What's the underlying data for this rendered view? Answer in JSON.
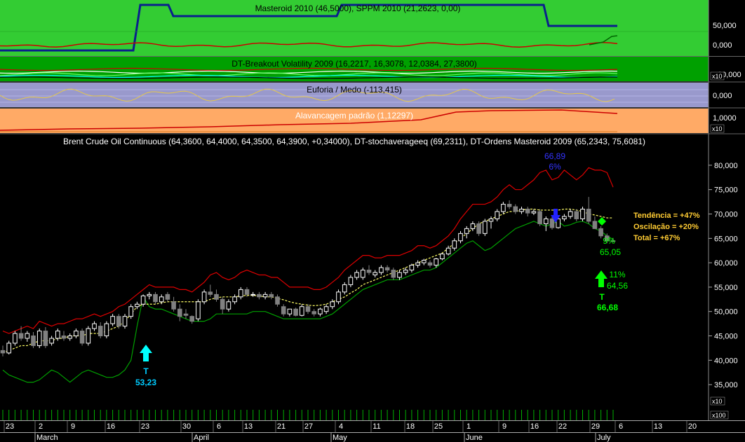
{
  "panels": {
    "p1": {
      "title": "Masteroid 2010 (46,5000), SPPM 2010 (21,2623, 0,00)",
      "ticks": [
        "50,000",
        "0,000"
      ]
    },
    "p2": {
      "title": "DT-Breakout Volatility 2009 (16,2217, 16,3078, 12,0384, 27,3800)",
      "ticks": [
        "10,000"
      ],
      "scale": "x10"
    },
    "p3": {
      "title": "Euforia / Medo (-113,415)",
      "ticks": [
        "0,000"
      ]
    },
    "p4": {
      "title": "Alavancagem padrão (1,12297)",
      "ticks": [
        "1,0000"
      ],
      "scale": "x10"
    },
    "main": {
      "title": "Brent Crude Oil Continuous (64,3600, 64,4000, 64,3500, 64,3900, +0,34000), DT-stochaverageeq (69,2311), DT-Ordens Masteroid 2009 (65,2343, 75,6081)",
      "volume_scales": [
        "x10",
        "x100"
      ]
    }
  },
  "annotations": {
    "buy1_label": "T",
    "buy1_price": "53,23",
    "sell_price": "66,89",
    "sell_pct": "6%",
    "pct_a": "9%",
    "price_a": "65,05",
    "pct_b": "11%",
    "price_b": "64,56",
    "buy2_label": "T",
    "buy2_price": "66,68"
  },
  "stats": [
    "Tendência = +47%",
    "Oscilação = +20%",
    "Total = +67%"
  ],
  "colors": {
    "panel1": "#33cc33",
    "panel2": "#00a000",
    "panel3": "#9999cc",
    "panel4": "#ffaa66",
    "up": "#ffffff",
    "down": "#808080",
    "upper_band": "#dd0000",
    "lower_band": "#00a000",
    "average": "#ffff66",
    "buy_arrow": "#00ffff",
    "sell_arrow": "#2222ff",
    "green_arrow": "#00ff00"
  },
  "chart_data": {
    "type": "candlestick",
    "ylim": [
      32,
      83
    ],
    "y_ticks": [
      "35,000",
      "40,000",
      "45,000",
      "50,000",
      "55,000",
      "60,000",
      "65,000",
      "70,000",
      "75,000",
      "80,000"
    ],
    "x_labels": [
      "23",
      "2",
      "9",
      "16",
      "23",
      "30",
      "6",
      "13",
      "21",
      "27",
      "4",
      "11",
      "18",
      "25",
      "1",
      "9",
      "16",
      "22",
      "29",
      "6",
      "13",
      "20"
    ],
    "months": [
      "March",
      "April",
      "May",
      "June",
      "July"
    ],
    "ohlc": [
      [
        42.0,
        43.0,
        40.8,
        41.5
      ],
      [
        41.5,
        44.0,
        41.2,
        43.5
      ],
      [
        43.5,
        46.0,
        43.0,
        45.5
      ],
      [
        45.5,
        47.0,
        44.0,
        44.5
      ],
      [
        44.5,
        46.0,
        43.8,
        45.5
      ],
      [
        45.0,
        45.8,
        42.5,
        43.0
      ],
      [
        43.0,
        46.5,
        42.5,
        46.0
      ],
      [
        46.0,
        46.8,
        42.5,
        43.0
      ],
      [
        43.5,
        45.0,
        43.0,
        44.5
      ],
      [
        44.5,
        46.5,
        44.0,
        46.0
      ],
      [
        45.0,
        46.0,
        44.0,
        44.5
      ],
      [
        44.5,
        45.5,
        44.0,
        45.0
      ],
      [
        45.0,
        46.5,
        44.5,
        46.0
      ],
      [
        46.0,
        46.5,
        43.0,
        43.5
      ],
      [
        43.5,
        47.0,
        43.0,
        46.5
      ],
      [
        46.5,
        48.0,
        46.0,
        47.5
      ],
      [
        47.0,
        47.8,
        44.5,
        45.0
      ],
      [
        45.0,
        48.0,
        44.5,
        47.5
      ],
      [
        47.5,
        49.5,
        47.0,
        49.0
      ],
      [
        49.0,
        49.5,
        46.5,
        47.0
      ],
      [
        47.0,
        49.5,
        46.5,
        49.0
      ],
      [
        49.0,
        51.5,
        48.5,
        51.0
      ],
      [
        51.0,
        52.0,
        50.5,
        51.5
      ],
      [
        51.5,
        53.5,
        51.0,
        53.2
      ],
      [
        53.2,
        54.0,
        52.5,
        53.5
      ],
      [
        53.5,
        54.0,
        51.5,
        52.0
      ],
      [
        52.0,
        53.5,
        51.5,
        53.0
      ],
      [
        53.5,
        54.0,
        52.0,
        52.5
      ],
      [
        52.0,
        53.0,
        50.0,
        50.5
      ],
      [
        50.5,
        51.5,
        48.0,
        49.0
      ],
      [
        49.5,
        50.5,
        48.5,
        49.2
      ],
      [
        49.0,
        49.2,
        47.5,
        48.0
      ],
      [
        48.5,
        52.5,
        48.0,
        52.0
      ],
      [
        52.0,
        54.5,
        51.5,
        54.0
      ],
      [
        54.0,
        55.5,
        53.0,
        53.5
      ],
      [
        53.5,
        54.5,
        52.0,
        52.5
      ],
      [
        52.5,
        53.0,
        49.5,
        50.5
      ],
      [
        50.5,
        52.5,
        50.0,
        52.0
      ],
      [
        52.0,
        53.5,
        51.5,
        53.0
      ],
      [
        53.0,
        55.0,
        52.5,
        54.5
      ],
      [
        54.5,
        55.0,
        53.0,
        53.5
      ],
      [
        53.5,
        54.0,
        53.0,
        53.5
      ],
      [
        53.5,
        54.0,
        52.5,
        53.0
      ],
      [
        53.0,
        54.0,
        52.5,
        53.5
      ],
      [
        53.5,
        54.0,
        52.5,
        53.0
      ],
      [
        53.0,
        53.5,
        51.0,
        51.5
      ],
      [
        51.0,
        51.5,
        49.0,
        49.5
      ],
      [
        49.5,
        50.5,
        49.0,
        50.5
      ],
      [
        50.5,
        50.8,
        49.0,
        49.2
      ],
      [
        49.2,
        51.5,
        49.0,
        51.0
      ],
      [
        51.0,
        51.5,
        49.5,
        50.0
      ],
      [
        50.0,
        50.5,
        49.0,
        49.5
      ],
      [
        49.5,
        50.8,
        49.0,
        50.5
      ],
      [
        50.0,
        51.5,
        49.5,
        51.0
      ],
      [
        51.0,
        52.5,
        50.5,
        52.0
      ],
      [
        52.0,
        54.5,
        51.5,
        54.0
      ],
      [
        54.0,
        56.0,
        53.5,
        55.5
      ],
      [
        55.5,
        57.5,
        55.0,
        57.0
      ],
      [
        57.0,
        58.5,
        56.5,
        58.0
      ],
      [
        57.0,
        59.0,
        56.5,
        58.5
      ],
      [
        58.5,
        59.5,
        57.5,
        58.0
      ],
      [
        57.5,
        58.5,
        57.0,
        58.0
      ],
      [
        58.0,
        59.5,
        57.5,
        59.0
      ],
      [
        59.0,
        59.5,
        58.0,
        58.5
      ],
      [
        58.5,
        59.0,
        56.5,
        57.0
      ],
      [
        57.0,
        58.5,
        56.5,
        58.0
      ],
      [
        58.0,
        59.0,
        57.5,
        58.5
      ],
      [
        58.5,
        59.8,
        58.0,
        59.5
      ],
      [
        59.5,
        60.5,
        59.0,
        60.0
      ],
      [
        60.0,
        60.8,
        59.5,
        60.5
      ],
      [
        60.0,
        60.5,
        59.0,
        59.5
      ],
      [
        59.5,
        61.0,
        59.0,
        60.8
      ],
      [
        60.8,
        62.0,
        60.5,
        61.8
      ],
      [
        61.8,
        63.5,
        61.5,
        63.0
      ],
      [
        63.0,
        65.0,
        62.5,
        64.5
      ],
      [
        64.5,
        66.5,
        64.0,
        66.0
      ],
      [
        66.0,
        67.5,
        65.0,
        67.0
      ],
      [
        67.0,
        68.5,
        66.5,
        68.0
      ],
      [
        68.0,
        68.5,
        65.5,
        66.0
      ],
      [
        66.0,
        69.0,
        65.5,
        68.5
      ],
      [
        68.5,
        69.5,
        67.0,
        69.0
      ],
      [
        69.0,
        71.0,
        68.5,
        70.5
      ],
      [
        70.5,
        72.5,
        70.0,
        72.0
      ],
      [
        72.0,
        72.8,
        71.0,
        71.5
      ],
      [
        71.5,
        72.0,
        70.0,
        70.5
      ],
      [
        70.5,
        71.5,
        70.0,
        71.0
      ],
      [
        71.0,
        71.5,
        69.5,
        70.2
      ],
      [
        70.2,
        71.0,
        69.8,
        70.5
      ],
      [
        70.5,
        71.0,
        67.5,
        68.0
      ],
      [
        68.0,
        69.5,
        66.5,
        69.0
      ],
      [
        69.0,
        69.5,
        66.8,
        67.2
      ],
      [
        67.2,
        69.5,
        67.0,
        69.0
      ],
      [
        69.0,
        70.0,
        68.5,
        69.5
      ],
      [
        69.5,
        71.0,
        69.0,
        70.5
      ],
      [
        70.5,
        71.0,
        68.5,
        69.0
      ],
      [
        69.0,
        71.5,
        68.5,
        71.0
      ],
      [
        71.0,
        73.5,
        68.0,
        68.5
      ],
      [
        68.5,
        69.5,
        67.0,
        67.0
      ],
      [
        67.0,
        67.5,
        65.0,
        65.5
      ],
      [
        65.5,
        66.0,
        64.0,
        64.5
      ],
      [
        64.5,
        65.0,
        64.3,
        64.4
      ]
    ],
    "upper_band": [
      46,
      45.5,
      46,
      46.5,
      47,
      46.5,
      48,
      47.5,
      47,
      47.5,
      47.5,
      48,
      48.5,
      48.5,
      49,
      49.5,
      49,
      49.5,
      50,
      51,
      51.5,
      52.5,
      53.5,
      54.5,
      55.5,
      55,
      55,
      55,
      55,
      54.5,
      54.5,
      54,
      55,
      56,
      57.5,
      58,
      57,
      56.5,
      57,
      58,
      58.5,
      58,
      57.5,
      57.5,
      57,
      57,
      56,
      55,
      55,
      55,
      55,
      54.5,
      54.5,
      55,
      56,
      57,
      58.5,
      59.5,
      60.5,
      61.5,
      61.5,
      61,
      61,
      61.5,
      61.5,
      61.5,
      62,
      62.5,
      63.5,
      63.5,
      63,
      63.5,
      64.5,
      65.5,
      67,
      69,
      70.5,
      72,
      72,
      72,
      72.5,
      73.5,
      75,
      76,
      75,
      75,
      76,
      77,
      78.5,
      79,
      77,
      77.5,
      79,
      78,
      77,
      78,
      79.5,
      79,
      79,
      78.5,
      75.5
    ],
    "avg_line": [
      41.5,
      42,
      42.5,
      43,
      43,
      43.5,
      44,
      44,
      44,
      44.5,
      44.5,
      45,
      45,
      45,
      45.5,
      45.5,
      45.5,
      46,
      46.5,
      47,
      48,
      49.5,
      51,
      51.5,
      51.5,
      51.5,
      51.8,
      52,
      52,
      52,
      52,
      52,
      52,
      52,
      52.5,
      52.8,
      53,
      53,
      53,
      53.2,
      53.3,
      53.3,
      53.2,
      53,
      53,
      52.7,
      52.4,
      52,
      51.7,
      51.5,
      51.3,
      51.2,
      51.3,
      51.5,
      52,
      52.5,
      53,
      53.8,
      54.5,
      55.5,
      56,
      56.5,
      57,
      57.5,
      58,
      58.5,
      59,
      59.5,
      60,
      60.5,
      61,
      61.5,
      62,
      63,
      64,
      65,
      66,
      67,
      68,
      68.5,
      69,
      69.5,
      70,
      70.5,
      70.5,
      70.8,
      71,
      71,
      70.8,
      70.8,
      70.8,
      70.8,
      71,
      71,
      70.8,
      70.5,
      70,
      69.8,
      69.5,
      69.2,
      69.2
    ],
    "lower_band": [
      38,
      37,
      36.5,
      36,
      35.5,
      35.5,
      36,
      37,
      38,
      37.5,
      36.5,
      35.5,
      36.5,
      37.5,
      38,
      37.5,
      37,
      36.5,
      36.5,
      37,
      38,
      40,
      47,
      53,
      51,
      50.5,
      50.5,
      50,
      49.5,
      49,
      48.5,
      48,
      48,
      48,
      48.5,
      49.5,
      49.5,
      49.5,
      49.5,
      49.5,
      49.5,
      50,
      50,
      50,
      49.5,
      49,
      48.5,
      48.5,
      48.5,
      48.5,
      48.5,
      48.5,
      48.5,
      49,
      49.5,
      50.5,
      51.5,
      52.5,
      53.5,
      54.5,
      55,
      55.5,
      56,
      56.5,
      56.5,
      56.5,
      57,
      57.5,
      58,
      58.5,
      58.5,
      59,
      60,
      61,
      62,
      63,
      64,
      64.5,
      63.5,
      62.5,
      63,
      64,
      65,
      66,
      67,
      67.5,
      68,
      68.5,
      68,
      67.5,
      68,
      68.5,
      67.5,
      67.8,
      68.3,
      68.5,
      68,
      67,
      66.5,
      65.5,
      64.8
    ]
  }
}
